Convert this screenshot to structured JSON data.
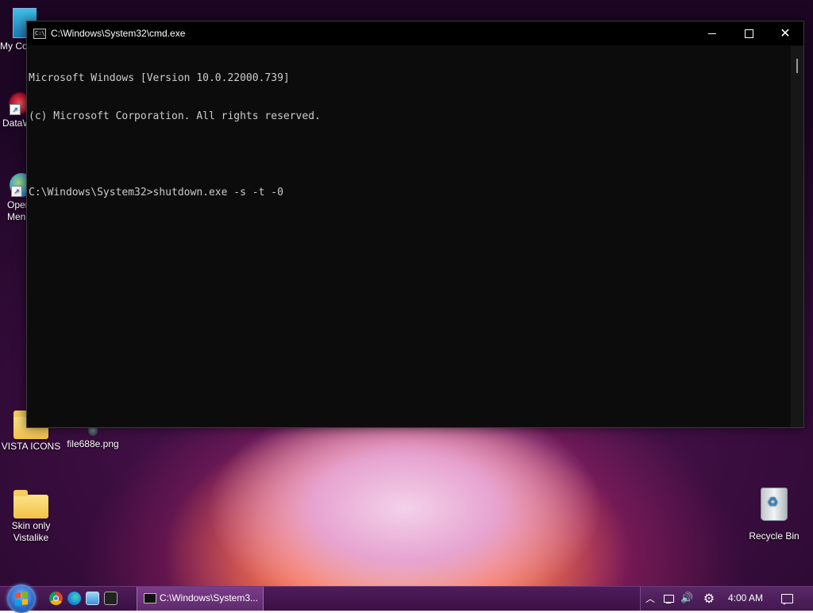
{
  "desktop": {
    "icons": [
      {
        "label": "My Co"
      },
      {
        "label": "DataW"
      },
      {
        "label": "Oper\nMen"
      },
      {
        "label": "VISTA ICONS"
      },
      {
        "label": "file688e.png"
      },
      {
        "label": "Skin only\nVistalike"
      },
      {
        "label": "Recycle Bin"
      }
    ]
  },
  "cmd_window": {
    "title": "C:\\Windows\\System32\\cmd.exe",
    "controls": {
      "minimize": "minimize",
      "maximize": "maximize",
      "close": "✕"
    },
    "console_lines": [
      "Microsoft Windows [Version 10.0.22000.739]",
      "(c) Microsoft Corporation. All rights reserved.",
      "",
      "C:\\Windows\\System32>shutdown.exe -s -t -0"
    ],
    "text_color": "#cccccc",
    "background_color": "#0c0c0c"
  },
  "taskbar": {
    "quick_launch": [
      "chrome-icon",
      "edge-icon",
      "explorer-icon",
      "cmd-icon"
    ],
    "tasks": [
      {
        "label": "C:\\Windows\\System3..."
      }
    ],
    "tray": {
      "clock": "4:00 AM",
      "chevron": "^",
      "volume": "🔊",
      "settings": "⚙"
    }
  }
}
